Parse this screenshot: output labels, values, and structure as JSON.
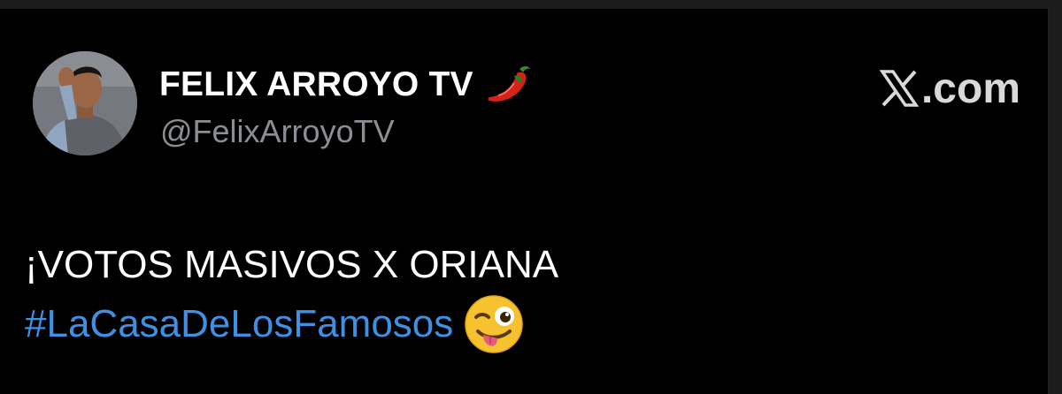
{
  "author": {
    "display_name": "FELIX ARROYO TV",
    "handle": "@FelixArroyoTV",
    "avatar_icon": "profile-photo",
    "badge_icon": "chili-pepper-icon"
  },
  "brand": {
    "label": ".com",
    "logo_icon": "x-logo-icon"
  },
  "tweet": {
    "text": "¡VOTOS MASIVOS X ORIANA",
    "hashtag": "#LaCasaDeLosFamosos",
    "emoji_icon": "winking-face-with-tongue-icon"
  },
  "colors": {
    "background": "#000000",
    "hashtag": "#3f90e2",
    "handle": "#8b8f94",
    "text": "#ffffff"
  }
}
